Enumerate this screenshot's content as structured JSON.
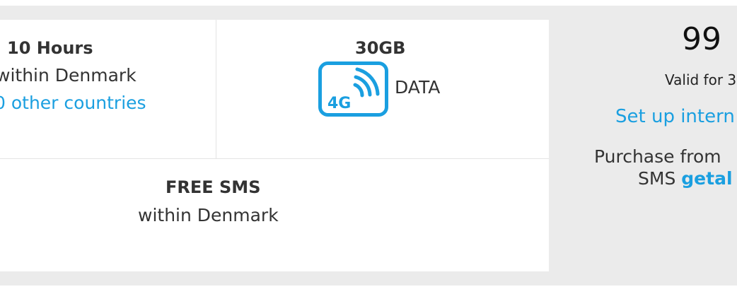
{
  "plan": {
    "voice": {
      "title": "10 Hours",
      "subtitle": "within Denmark",
      "link": "0 other countries"
    },
    "data": {
      "title": "30GB",
      "badge": "4G",
      "label": "DATA"
    },
    "sms": {
      "title": "FREE SMS",
      "subtitle": "within Denmark"
    }
  },
  "price_panel": {
    "price": "99",
    "validity": "Valid for 3",
    "setup_link": "Set up intern",
    "purchase_line": "Purchase from",
    "sms_prefix": "SMS",
    "sms_code": "getal"
  },
  "colors": {
    "accent": "#1a9fe0",
    "panel_bg": "#ebebeb"
  },
  "icons": [
    "4g-signal-icon"
  ]
}
